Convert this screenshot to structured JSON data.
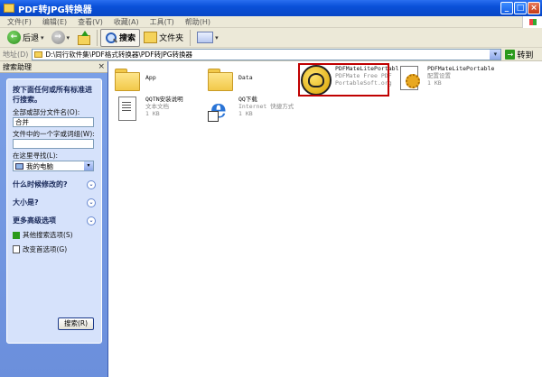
{
  "window": {
    "title": "PDF转JPG转换器"
  },
  "menu": [
    "文件(F)",
    "编辑(E)",
    "查看(V)",
    "收藏(A)",
    "工具(T)",
    "帮助(H)"
  ],
  "toolbar": {
    "back": "后退",
    "search": "搜索",
    "folders": "文件夹"
  },
  "address": {
    "label": "地址(D)",
    "path": "D:\\同行软件集\\PDF格式转换器\\PDF转JPG转换器",
    "go": "转到"
  },
  "search_panel": {
    "header": "搜索助理",
    "title": "按下面任何或所有标准进行搜索。",
    "name_label": "全部或部分文件名(O):",
    "name_value": "合并",
    "word_label": "文件中的一个字或词组(W):",
    "word_value": "",
    "look_in_label": "在这里寻找(L):",
    "look_in_value": "我的电脑",
    "when_modified": "什么时候修改的?",
    "size": "大小是?",
    "advanced": "更多高级选项",
    "other_options": "其他搜索选项(S)",
    "change_prefs": "改变首选项(G)",
    "search_button": "搜索(R)"
  },
  "files": {
    "app": {
      "name": "App"
    },
    "data": {
      "name": "Data"
    },
    "pdfmate": {
      "name": "PDFMateLitePortabl",
      "line2": "PDFMate Free PDF",
      "line3": "PortableSoft.org"
    },
    "pdfmate_ini": {
      "name": "PDFMateLitePortable",
      "line2": "配置设置",
      "line3": "1 KB"
    },
    "qqtn": {
      "name": "QQTN安装说明",
      "line2": "文本文档",
      "line3": "1 KB"
    },
    "qq": {
      "name": "QQ下载",
      "line2": "Internet 快捷方式",
      "line3": "1 KB"
    }
  }
}
